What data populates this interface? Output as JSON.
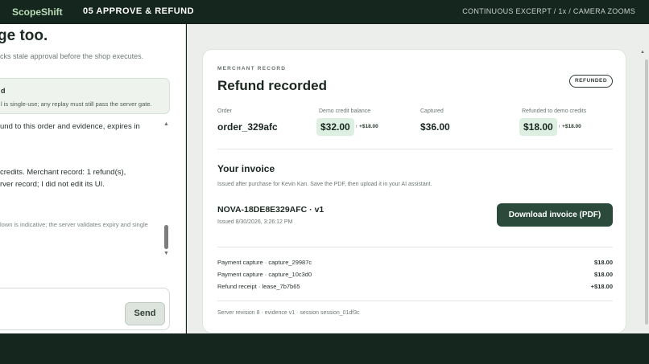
{
  "header": {
    "brand": "ScopeShift",
    "step": "05  APPROVE & REFUND",
    "mode": "CONTINUOUS EXCERPT  /  1x  /  CAMERA ZOOMS"
  },
  "left": {
    "heading": "ge too.",
    "subtitle": "cks stale approval before the shop executes.",
    "notice": {
      "title": "d",
      "body": "l is single-use; any replay must still pass the server gate."
    },
    "messages": [
      "und to this order and evidence, expires in",
      "credits. Merchant record: 1 refund(s),",
      "rver record; I did not edit its UI.",
      "lown is indicative; the server validates expiry and single"
    ],
    "composer": {
      "placeholder": "",
      "send_label": "Send"
    }
  },
  "card": {
    "eyebrow": "MERCHANT RECORD",
    "title": "Refund recorded",
    "status": "REFUNDED",
    "stats": [
      {
        "label": "Order",
        "value": "order_329afc"
      },
      {
        "label": "Demo credit balance",
        "value": "$32.00",
        "delta": "↑ +$18.00"
      },
      {
        "label": "Captured",
        "value": "$36.00"
      },
      {
        "label": "Refunded to demo credits",
        "value": "$18.00",
        "delta": "↑ +$18.00"
      }
    ],
    "invoice": {
      "title": "Your invoice",
      "subtitle": "Issued after purchase for Kevin Kan. Save the PDF, then upload it in your AI assistant.",
      "id": "NOVA-18DE8E329AFC · v1",
      "issued": "Issued 8/30/2026, 3:26:12 PM",
      "download_label": "Download invoice (PDF)"
    },
    "line_items": [
      {
        "label": "Payment capture · capture_29987c",
        "amount": "$18.00"
      },
      {
        "label": "Payment capture · capture_10c3d0",
        "amount": "$18.00"
      },
      {
        "label": "Refund receipt · lease_7b7b65",
        "amount": "+$18.00"
      }
    ],
    "meta": "Server revision 8 · evidence v1 · session session_01df3c"
  },
  "colors": {
    "dark": "#15261e",
    "accent": "#2b4a3c",
    "highlight": "#dcefe0"
  }
}
